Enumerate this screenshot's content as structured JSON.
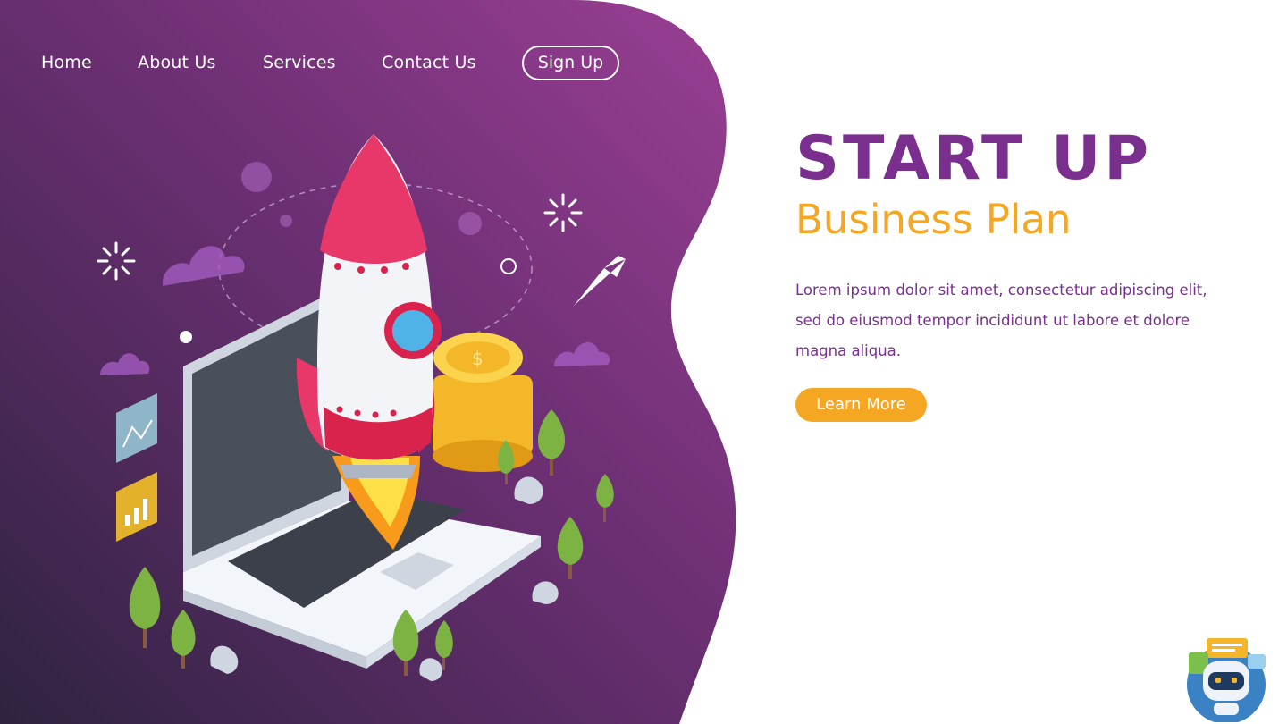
{
  "nav": {
    "items": [
      {
        "label": "Home"
      },
      {
        "label": "About Us"
      },
      {
        "label": "Services"
      },
      {
        "label": "Contact Us"
      }
    ],
    "signup_label": "Sign Up"
  },
  "hero": {
    "title": "START UP",
    "subtitle": "Business Plan",
    "body": "Lorem ipsum dolor sit amet, consectetur adipiscing elit, sed do eiusmod tempor incididunt ut labore et dolore magna aliqua.",
    "cta_label": "Learn More"
  },
  "colors": {
    "hero_gradient_start": "#2e2340",
    "hero_gradient_end": "#9a3f94",
    "title": "#7a2e8e",
    "accent": "#f5a623",
    "rocket": "#e8386a",
    "laptop": "#e8ecf2"
  },
  "icons": {
    "illustration": "rocket-launch-laptop-illustration",
    "chatbot": "chatbot-robot-icon"
  }
}
